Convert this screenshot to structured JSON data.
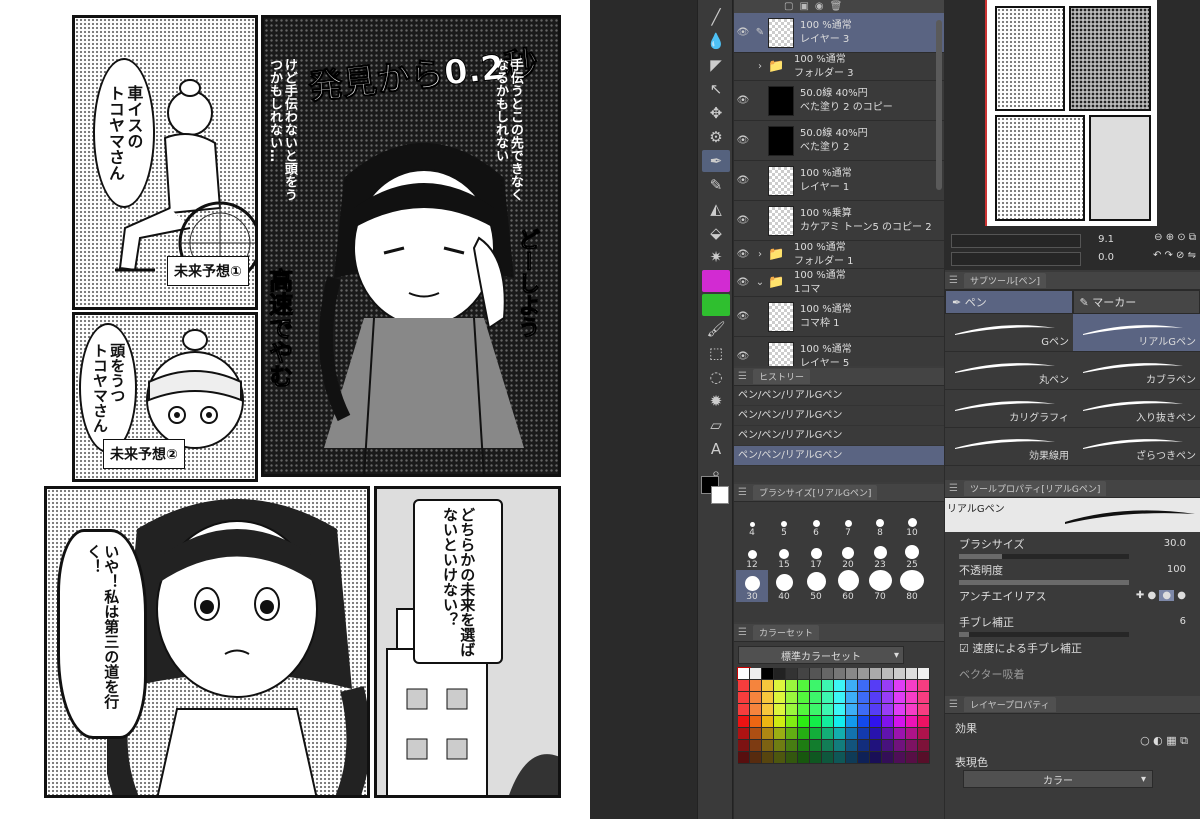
{
  "manga": {
    "label_wheelchair": "車イスの\nトコヤマさん",
    "caption_forecast1": "未来予想①",
    "label_headbump": "頭をうつ\nトコヤマさん",
    "caption_forecast2": "未来予想②",
    "title_discovery": "発見から0.2秒",
    "thought_1": "手伝うとこの先できなくなるかもしれない",
    "thought_2": "けど手伝わないと頭をうつかもしれない…",
    "sfx_fast": "高速でやむ",
    "sfx_dooshiyou": "どーしよう",
    "shout": "いや！私は第三の道を行く！",
    "question": "どちらかの未来を選ばないといけない？"
  },
  "toolbar": {
    "tools": [
      "line-icon",
      "fill-icon",
      "shape-icon",
      "select-icon",
      "move-icon",
      "zoom-icon",
      "pen-icon",
      "pencil-icon",
      "eraser-icon",
      "bucket-icon",
      "sparkle-icon",
      "magenta-tool",
      "green-tool",
      "brush-icon",
      "rect-select-icon",
      "lasso-icon",
      "burst-icon",
      "ruler-icon",
      "text-icon",
      "magnify-icon"
    ]
  },
  "layers": {
    "rows": [
      {
        "name": "100 %通常",
        "sub": "レイヤー 3",
        "visible": true,
        "selected": true,
        "thumb": "transparent"
      },
      {
        "name": "100 %通常",
        "sub": "フォルダー 3",
        "visible": false,
        "selected": false,
        "thumb": "folder"
      },
      {
        "name": "50.0線 40%円",
        "sub": "べた塗り 2 のコピー",
        "visible": true,
        "selected": false,
        "thumb": "black"
      },
      {
        "name": "50.0線 40%円",
        "sub": "べた塗り 2",
        "visible": true,
        "selected": false,
        "thumb": "black"
      },
      {
        "name": "100 %通常",
        "sub": "レイヤー 1",
        "visible": true,
        "selected": false,
        "thumb": "transparent"
      },
      {
        "name": "100 %乗算",
        "sub": "カケアミ トーン5 のコピー 2",
        "visible": true,
        "selected": false,
        "thumb": "transparent"
      },
      {
        "name": "100 %通常",
        "sub": "フォルダー 1",
        "visible": true,
        "selected": false,
        "thumb": "folder"
      },
      {
        "name": "100 %通常",
        "sub": "1コマ",
        "visible": true,
        "selected": false,
        "thumb": "folder-open"
      },
      {
        "name": "100 %通常",
        "sub": "コマ枠 1",
        "visible": true,
        "selected": false,
        "thumb": "frame"
      },
      {
        "name": "100 %通常",
        "sub": "レイヤー 5",
        "visible": true,
        "selected": false,
        "thumb": "transparent"
      }
    ]
  },
  "history": {
    "tab": "ヒストリー",
    "rows": [
      "ペン/ペン/リアルGペン",
      "ペン/ペン/リアルGペン",
      "ペン/ペン/リアルGペン",
      "ペン/ペン/リアルGペン"
    ]
  },
  "brushsize": {
    "tab": "ブラシサイズ[リアルGペン]",
    "sizes": [
      "4",
      "5",
      "6",
      "7",
      "8",
      "10",
      "12",
      "15",
      "17",
      "20",
      "23",
      "25",
      "30",
      "40",
      "50",
      "60",
      "70",
      "80"
    ],
    "selected": "30"
  },
  "colorset": {
    "tab": "カラーセット",
    "set_name": "標準カラーセット"
  },
  "navigator": {
    "zoom": "9.1",
    "rotate": "0.0"
  },
  "subtool": {
    "tab": "サブツール[ペン]",
    "tabs": [
      "ペン",
      "マーカー"
    ],
    "items": [
      "Gペン",
      "リアルGペン",
      "丸ペン",
      "カブラペン",
      "カリグラフィ",
      "入り抜きペン",
      "効果線用",
      "ざらつきペン"
    ],
    "selected": "リアルGペン"
  },
  "toolprops": {
    "tab": "ツールプロパティ[リアルGペン]",
    "preview_name": "リアルGペン",
    "brush_size_label": "ブラシサイズ",
    "brush_size_val": "30.0",
    "opacity_label": "不透明度",
    "opacity_val": "100",
    "antialias_label": "アンチエイリアス",
    "stabilization_label": "手ブレ補正",
    "stabilization_val": "6",
    "speed_label": "速度による手ブレ補正",
    "vector_label": "ベクター吸着"
  },
  "layerprops": {
    "tab": "レイヤープロパティ",
    "effect_label": "効果",
    "color_label": "表現色",
    "color_mode": "カラー"
  }
}
